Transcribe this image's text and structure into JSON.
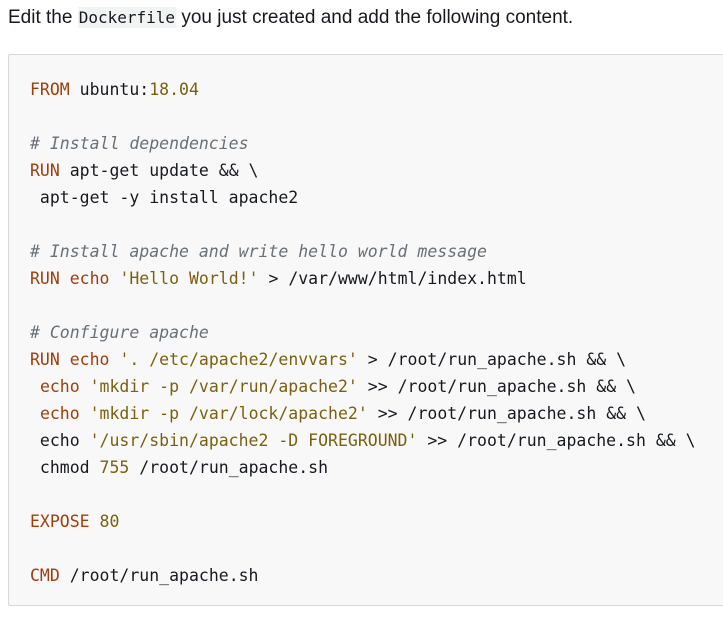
{
  "intro": {
    "before": "Edit the ",
    "code": "Dockerfile",
    "after": " you just created and add the following content."
  },
  "code_lines": [
    [
      {
        "t": "kw",
        "v": "FROM"
      },
      {
        "t": "plain",
        "v": " ubuntu:"
      },
      {
        "t": "num",
        "v": "18.04"
      }
    ],
    [],
    [
      {
        "t": "cm",
        "v": "# Install dependencies"
      }
    ],
    [
      {
        "t": "kw",
        "v": "RUN"
      },
      {
        "t": "plain",
        "v": " apt-get update && \\"
      }
    ],
    [
      {
        "t": "plain",
        "v": " apt-get -y install apache2"
      }
    ],
    [],
    [
      {
        "t": "cm",
        "v": "# Install apache and write hello world message"
      }
    ],
    [
      {
        "t": "kw",
        "v": "RUN"
      },
      {
        "t": "plain",
        "v": " "
      },
      {
        "t": "kw",
        "v": "echo"
      },
      {
        "t": "plain",
        "v": " "
      },
      {
        "t": "st",
        "v": "'Hello World!'"
      },
      {
        "t": "plain",
        "v": " > /var/www/html/index.html"
      }
    ],
    [],
    [
      {
        "t": "cm",
        "v": "# Configure apache"
      }
    ],
    [
      {
        "t": "kw",
        "v": "RUN"
      },
      {
        "t": "plain",
        "v": " "
      },
      {
        "t": "kw",
        "v": "echo"
      },
      {
        "t": "plain",
        "v": " "
      },
      {
        "t": "st",
        "v": "'. /etc/apache2/envvars'"
      },
      {
        "t": "plain",
        "v": " > /root/run_apache.sh && \\"
      }
    ],
    [
      {
        "t": "plain",
        "v": " "
      },
      {
        "t": "kw",
        "v": "echo"
      },
      {
        "t": "plain",
        "v": " "
      },
      {
        "t": "st",
        "v": "'mkdir -p /var/run/apache2'"
      },
      {
        "t": "plain",
        "v": " >> /root/run_apache.sh && \\"
      }
    ],
    [
      {
        "t": "plain",
        "v": " "
      },
      {
        "t": "kw",
        "v": "echo"
      },
      {
        "t": "plain",
        "v": " "
      },
      {
        "t": "st",
        "v": "'mkdir -p /var/lock/apache2'"
      },
      {
        "t": "plain",
        "v": " >> /root/run_apache.sh && \\"
      }
    ],
    [
      {
        "t": "plain",
        "v": " echo "
      },
      {
        "t": "st",
        "v": "'/usr/sbin/apache2 -D FOREGROUND'"
      },
      {
        "t": "plain",
        "v": " >> /root/run_apache.sh && \\"
      }
    ],
    [
      {
        "t": "plain",
        "v": " chmod "
      },
      {
        "t": "num",
        "v": "755"
      },
      {
        "t": "plain",
        "v": " /root/run_apache.sh"
      }
    ],
    [],
    [
      {
        "t": "kw",
        "v": "EXPOSE"
      },
      {
        "t": "plain",
        "v": " "
      },
      {
        "t": "num",
        "v": "80"
      }
    ],
    [],
    [
      {
        "t": "kw",
        "v": "CMD"
      },
      {
        "t": "plain",
        "v": " /root/run_apache.sh"
      }
    ]
  ],
  "colors": {
    "keyword": "#a03e0b",
    "comment": "#687078",
    "string": "#7a6010",
    "text": "#16191f",
    "code_bg": "#f8f8f8",
    "border": "#d5dbdb"
  }
}
